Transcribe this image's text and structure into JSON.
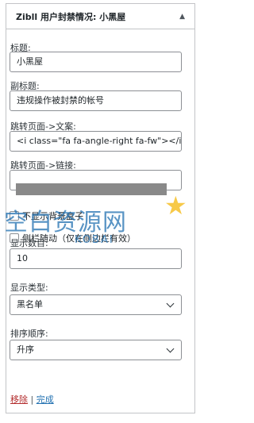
{
  "widget": {
    "title": "Zibll 用户封禁情况: 小黑屋",
    "toggle_icon": "caret-up-icon"
  },
  "fields": {
    "title_label": "标题:",
    "title_value": "小黑屋",
    "subtitle_label": "副标题:",
    "subtitle_value": "违规操作被封禁的帐号",
    "link_text_label": "跳转页面->文案:",
    "link_text_value": "<i class=\"fa fa-angle-right fa-fw\"></i>",
    "link_url_label": "跳转页面->链接:",
    "link_url_value": ""
  },
  "checkboxes": {
    "hide_bg": "不显示背景盒子",
    "sidebar_follow": "侧栏随动（仅在侧边栏有效）"
  },
  "display": {
    "count_label": "显示数目:",
    "count_value": "10",
    "type_label": "显示类型:",
    "type_value": "黑名单",
    "order_label": "排序顺序:",
    "order_value": "升序"
  },
  "footer": {
    "remove": "移除",
    "separator": "|",
    "done": "完成"
  },
  "watermark": {
    "main": "空白资源网",
    "sub": "KOBAI"
  }
}
